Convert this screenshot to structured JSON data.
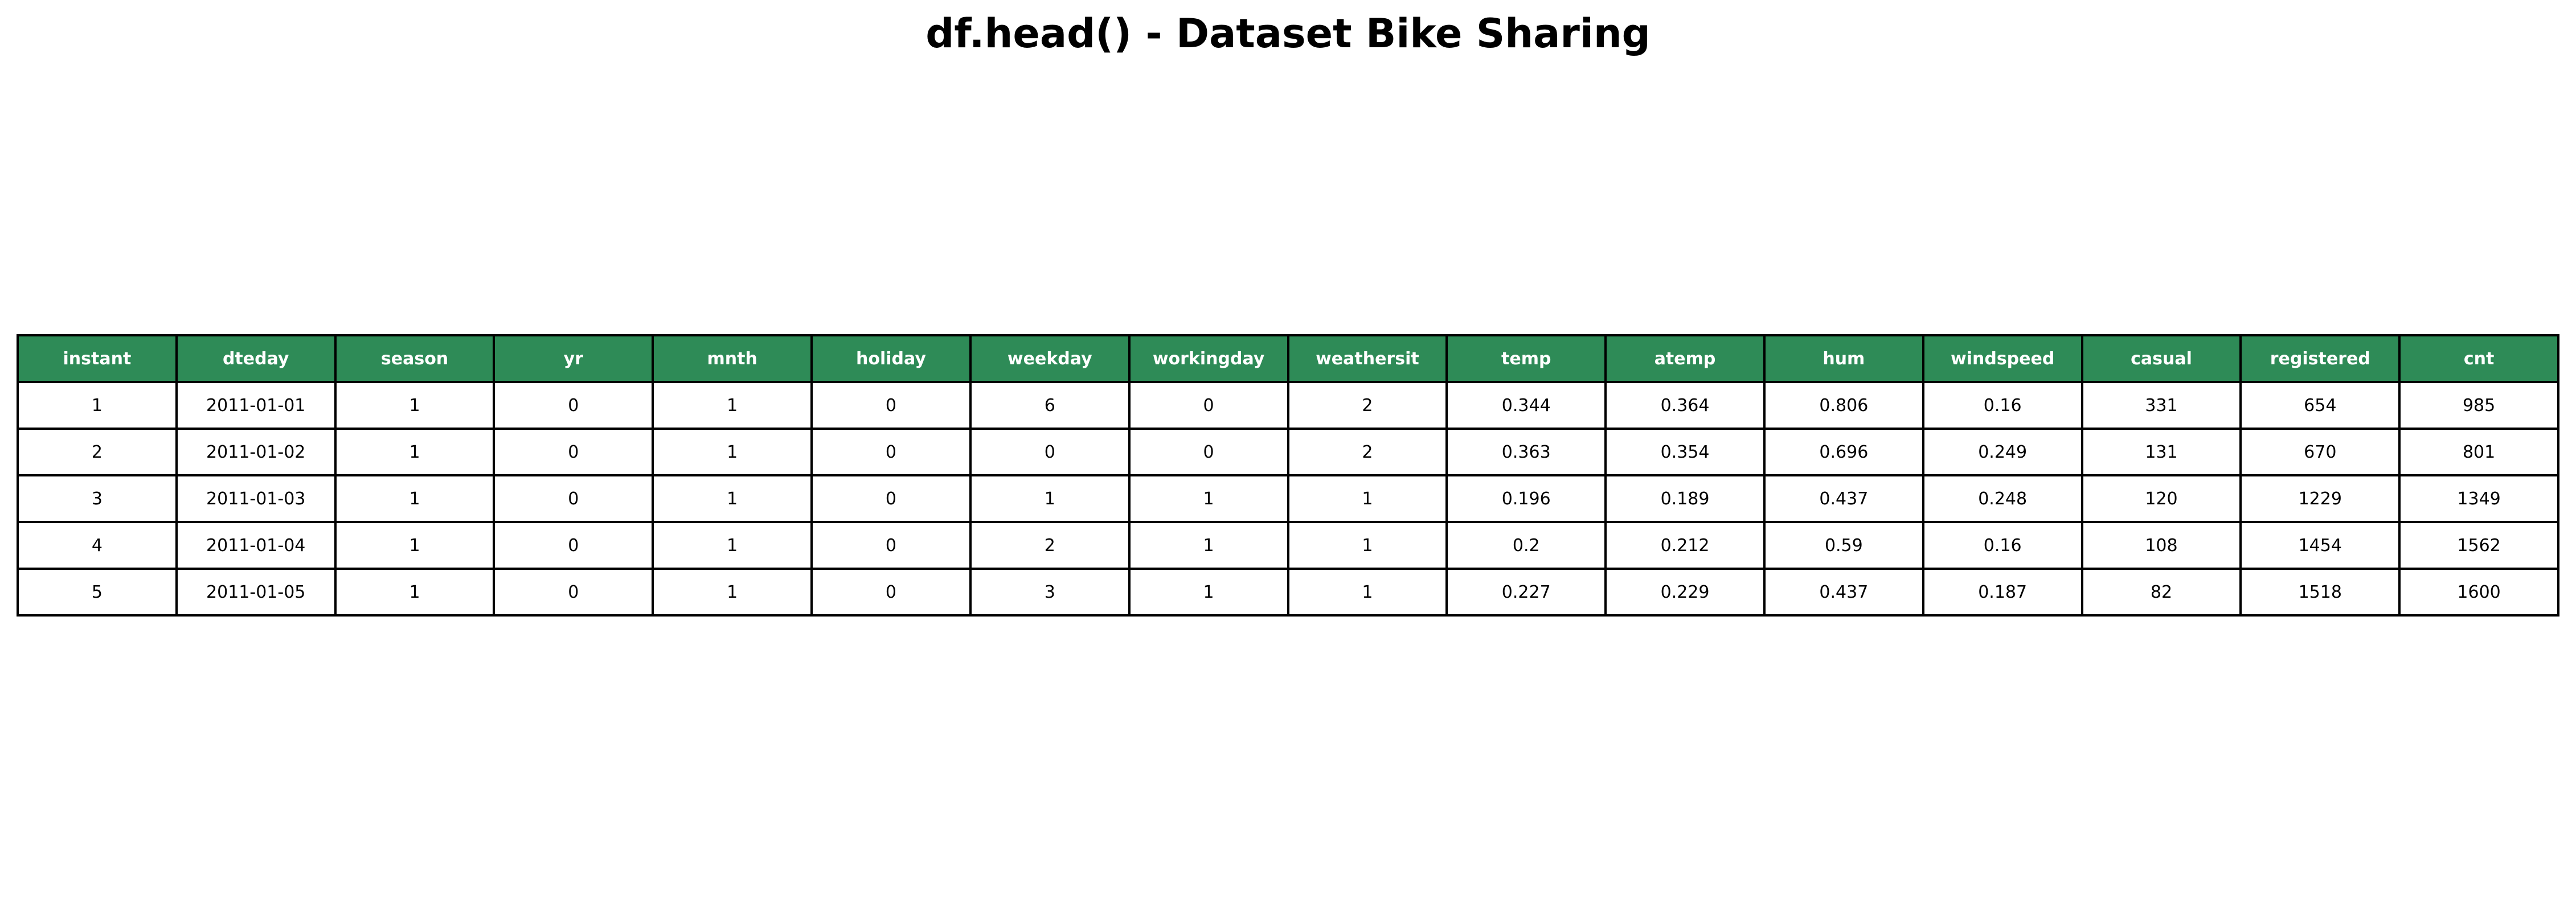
{
  "chart_data": {
    "type": "table",
    "title": "df.head() - Dataset Bike Sharing",
    "header_color": "#2e8b57",
    "header_text_color": "#ffffff",
    "columns": [
      "instant",
      "dteday",
      "season",
      "yr",
      "mnth",
      "holiday",
      "weekday",
      "workingday",
      "weathersit",
      "temp",
      "atemp",
      "hum",
      "windspeed",
      "casual",
      "registered",
      "cnt"
    ],
    "rows": [
      [
        "1",
        "2011-01-01",
        "1",
        "0",
        "1",
        "0",
        "6",
        "0",
        "2",
        "0.344",
        "0.364",
        "0.806",
        "0.16",
        "331",
        "654",
        "985"
      ],
      [
        "2",
        "2011-01-02",
        "1",
        "0",
        "1",
        "0",
        "0",
        "0",
        "2",
        "0.363",
        "0.354",
        "0.696",
        "0.249",
        "131",
        "670",
        "801"
      ],
      [
        "3",
        "2011-01-03",
        "1",
        "0",
        "1",
        "0",
        "1",
        "1",
        "1",
        "0.196",
        "0.189",
        "0.437",
        "0.248",
        "120",
        "1229",
        "1349"
      ],
      [
        "4",
        "2011-01-04",
        "1",
        "0",
        "1",
        "0",
        "2",
        "1",
        "1",
        "0.2",
        "0.212",
        "0.59",
        "0.16",
        "108",
        "1454",
        "1562"
      ],
      [
        "5",
        "2011-01-05",
        "1",
        "0",
        "1",
        "0",
        "3",
        "1",
        "1",
        "0.227",
        "0.229",
        "0.437",
        "0.187",
        "82",
        "1518",
        "1600"
      ]
    ]
  }
}
